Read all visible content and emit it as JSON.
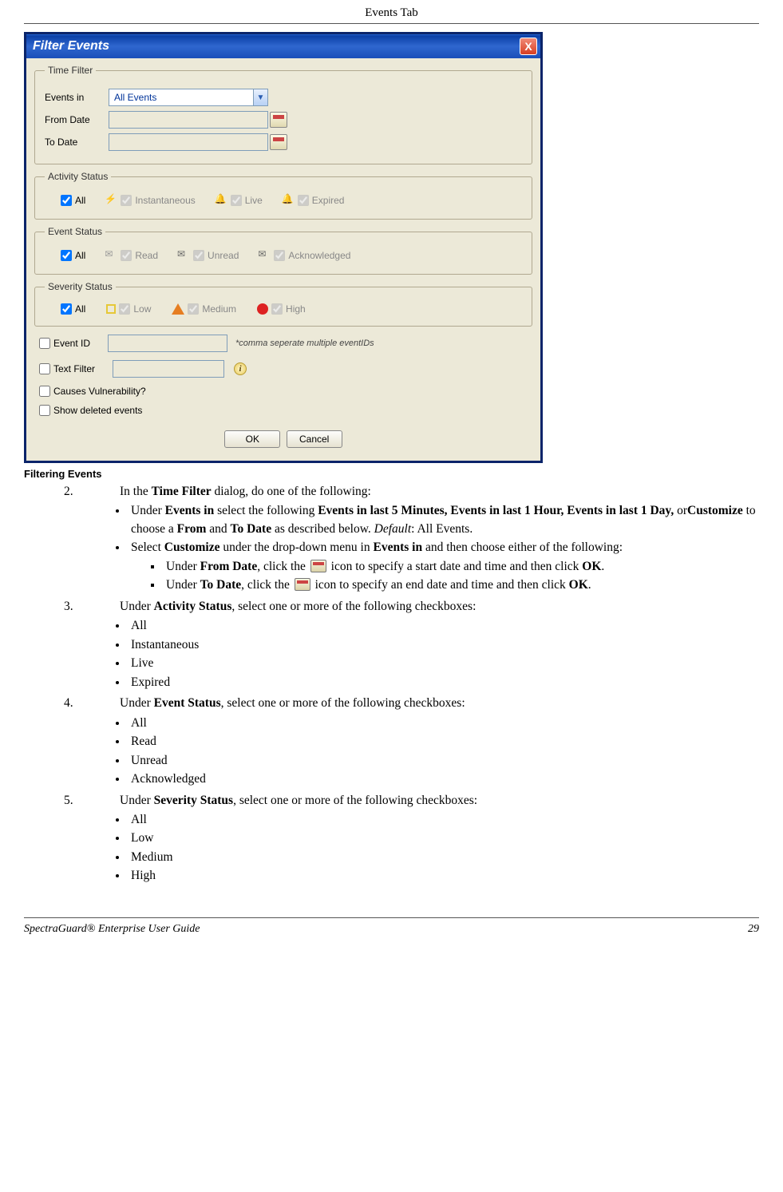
{
  "header": {
    "title": "Events Tab"
  },
  "footer": {
    "guide": "SpectraGuard® Enterprise User Guide",
    "page": "29"
  },
  "dialog": {
    "title": "Filter Events",
    "close": "X",
    "time_filter": {
      "legend": "Time Filter",
      "events_in_label": "Events in",
      "events_in_value": "All Events",
      "from_label": "From Date",
      "to_label": "To Date"
    },
    "activity": {
      "legend": "Activity Status",
      "all": "All",
      "instant": "Instantaneous",
      "live": "Live",
      "expired": "Expired"
    },
    "event_status": {
      "legend": "Event Status",
      "all": "All",
      "read": "Read",
      "unread": "Unread",
      "ack": "Acknowledged"
    },
    "severity": {
      "legend": "Severity Status",
      "all": "All",
      "low": "Low",
      "medium": "Medium",
      "high": "High"
    },
    "event_id": {
      "label": "Event ID",
      "note": "*comma seperate multiple eventIDs"
    },
    "text_filter": {
      "label": "Text Filter"
    },
    "vuln": {
      "label": "Causes Vulnerability?"
    },
    "deleted": {
      "label": "Show deleted events"
    },
    "ok": "OK",
    "cancel": "Cancel"
  },
  "caption": "Filtering Events",
  "steps": {
    "s2": {
      "num": "2.",
      "text_a": "In the ",
      "text_b": "Time Filter",
      "text_c": " dialog, do one of the following:",
      "b1_a": "Under ",
      "b1_b": "Events in",
      "b1_c": " select the following ",
      "b1_d": "Events in last 5 Minutes, Events in last 1 Hour, Events in last 1 Day,",
      "b1_e": " or",
      "b1_f": "Customize",
      "b1_g": " to choose a ",
      "b1_h": "From",
      "b1_i": " and ",
      "b1_j": "To Date",
      "b1_k": " as described below. ",
      "b1_l": "Default",
      "b1_m": ": All Events.",
      "b2_a": "Select ",
      "b2_b": "Customize",
      "b2_c": " under the drop-down menu in ",
      "b2_d": "Events in",
      "b2_e": " and then choose either of the following:",
      "sub1_a": "Under ",
      "sub1_b": "From Date",
      "sub1_c": ", click the ",
      "sub1_d": " icon to specify a start date and time and then click ",
      "sub1_e": "OK",
      "sub1_f": ".",
      "sub2_a": "Under ",
      "sub2_b": "To Date",
      "sub2_c": ", click the ",
      "sub2_d": " icon to specify an end date and time and then click ",
      "sub2_e": "OK",
      "sub2_f": "."
    },
    "s3": {
      "num": "3.",
      "text_a": "Under ",
      "text_b": "Activity Status",
      "text_c": ", select one or more of the following checkboxes:",
      "items": [
        "All",
        "Instantaneous",
        "Live",
        "Expired"
      ]
    },
    "s4": {
      "num": "4.",
      "text_a": "Under ",
      "text_b": "Event Status",
      "text_c": ", select one or more of the following checkboxes:",
      "items": [
        "All",
        "Read",
        "Unread",
        "Acknowledged"
      ]
    },
    "s5": {
      "num": "5.",
      "text_a": "Under ",
      "text_b": "Severity Status",
      "text_c": ", select one or more of the following checkboxes:",
      "items": [
        "All",
        "Low",
        "Medium",
        "High"
      ]
    }
  }
}
